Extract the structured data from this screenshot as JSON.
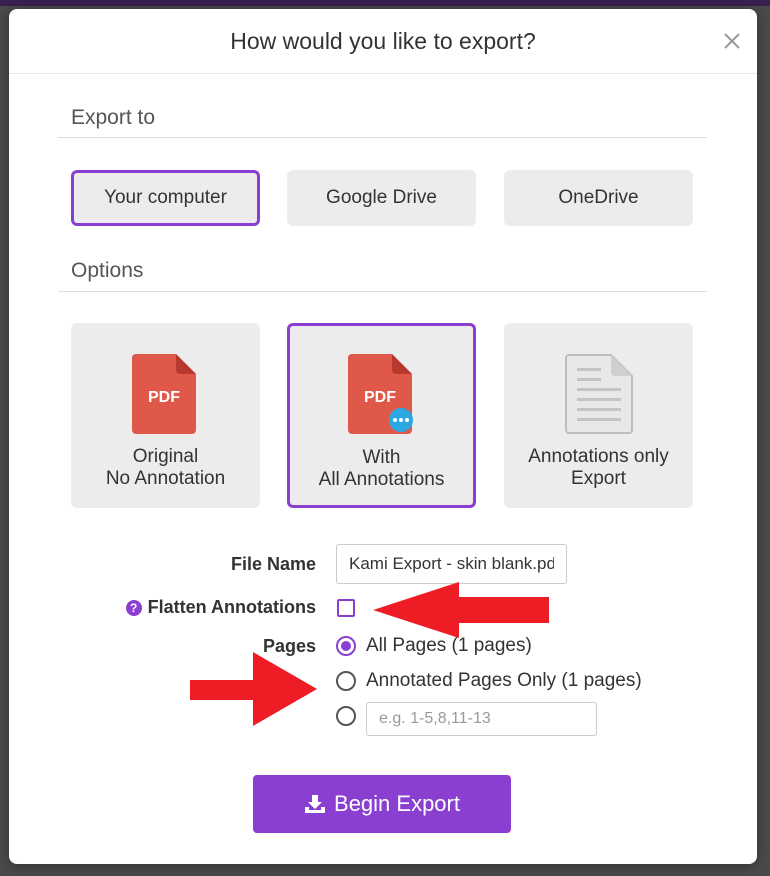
{
  "dialog": {
    "title": "How would you like to export?",
    "close_label": "close"
  },
  "export_to": {
    "heading": "Export to",
    "destinations": [
      {
        "label": "Your computer",
        "selected": true
      },
      {
        "label": "Google Drive",
        "selected": false
      },
      {
        "label": "OneDrive",
        "selected": false
      }
    ]
  },
  "options": {
    "heading": "Options",
    "items": [
      {
        "line1": "Original",
        "line2": "No Annotation",
        "icon": "pdf-icon",
        "icon_text": "PDF",
        "selected": false
      },
      {
        "line1": "With",
        "line2": "All Annotations",
        "icon": "pdf-comment-icon",
        "icon_text": "PDF",
        "selected": true
      },
      {
        "line1": "Annotations only",
        "line2": "Export",
        "icon": "document-icon",
        "selected": false
      }
    ]
  },
  "form": {
    "file_name_label": "File Name",
    "file_name_value": "Kami Export - skin blank.pdf",
    "flatten_label": "Flatten Annotations",
    "flatten_help_glyph": "?",
    "flatten_checked": false,
    "pages_label": "Pages",
    "pages_options": [
      {
        "label": "All Pages (1 pages)",
        "checked": true
      },
      {
        "label": "Annotated Pages Only (1 pages)",
        "checked": false
      }
    ],
    "custom_range_placeholder": "e.g. 1-5,8,11-13"
  },
  "export_button": {
    "label": "Begin Export",
    "icon": "download-icon"
  },
  "colors": {
    "accent": "#8a3fd1",
    "pdf_red": "#e0584a",
    "annotation_arrow": "#ee1c24",
    "card_bg": "#ececec"
  }
}
